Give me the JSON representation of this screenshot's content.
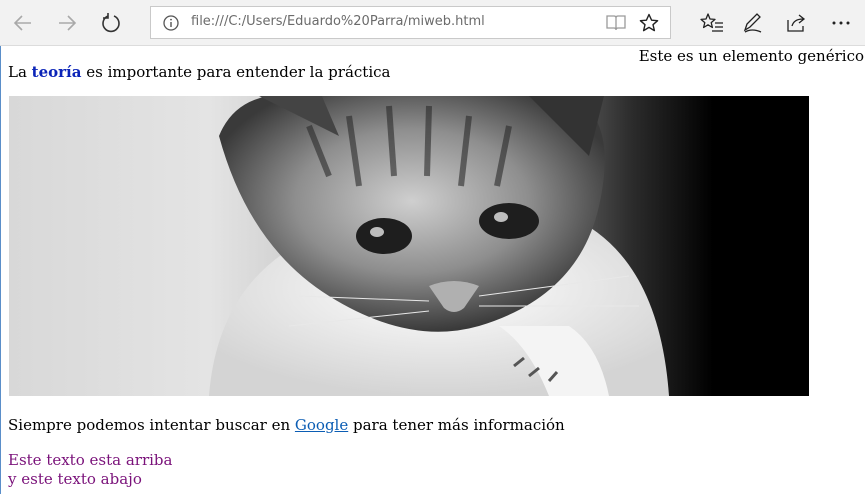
{
  "browser": {
    "url": "file:///C:/Users/Eduardo%20Parra/miweb.html"
  },
  "page": {
    "generic_element": "Este es un elemento genérico",
    "intro_before": "La ",
    "intro_bold": "teoría",
    "intro_after": " es importante para entender la práctica",
    "search_before": "Siempre podemos intentar buscar en ",
    "search_link": "Google",
    "search_after": " para tener más información",
    "line_top": "Este texto esta arriba",
    "line_bottom": "y este texto abajo"
  },
  "image": {
    "subject": "kitten-photo",
    "style": "grayscale"
  },
  "colors": {
    "bold_text": "#0b24b8",
    "link": "#0b5db4",
    "purple_text": "#7a127a"
  }
}
